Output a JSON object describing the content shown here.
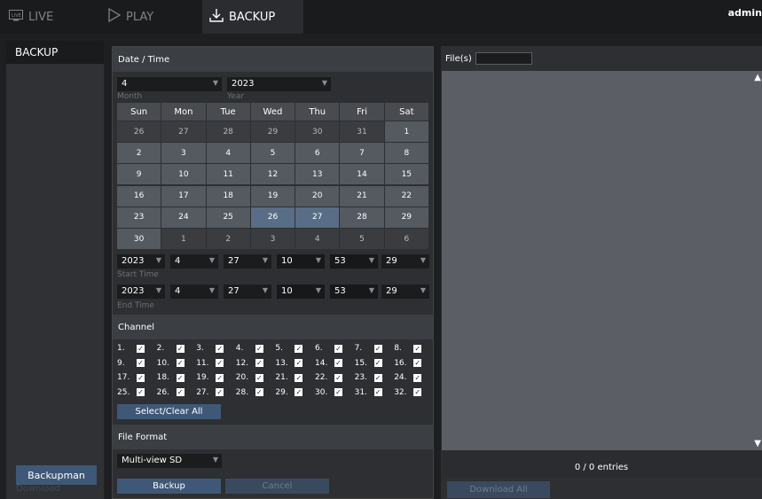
{
  "nav": {
    "tabs": [
      {
        "icon": "live-icon",
        "label": "LIVE"
      },
      {
        "icon": "play-icon",
        "label": "PLAY"
      },
      {
        "icon": "download-icon",
        "label": "BACKUP"
      }
    ],
    "user": "admin"
  },
  "sidebar": {
    "active_item": "BACKUP",
    "backupman_button": "Backupman",
    "download_label": "Download"
  },
  "date_time": {
    "header": "Date / Time",
    "month": {
      "value": "4",
      "label": "Month"
    },
    "year": {
      "value": "2023",
      "label": "Year"
    },
    "weekdays": [
      "Sun",
      "Mon",
      "Tue",
      "Wed",
      "Thu",
      "Fri",
      "Sat"
    ],
    "weeks": [
      [
        "26",
        "27",
        "28",
        "29",
        "30",
        "31",
        "1"
      ],
      [
        "2",
        "3",
        "4",
        "5",
        "6",
        "7",
        "8"
      ],
      [
        "9",
        "10",
        "11",
        "12",
        "13",
        "14",
        "15"
      ],
      [
        "16",
        "17",
        "18",
        "19",
        "20",
        "21",
        "22"
      ],
      [
        "23",
        "24",
        "25",
        "26",
        "27",
        "28",
        "29"
      ],
      [
        "30",
        "1",
        "2",
        "3",
        "4",
        "5",
        "6"
      ]
    ],
    "selected_days": [
      "26",
      "27"
    ],
    "start": {
      "year": "2023",
      "month": "4",
      "day": "27",
      "hour": "10",
      "minute": "53",
      "second": "29",
      "label": "Start Time"
    },
    "end": {
      "year": "2023",
      "month": "4",
      "day": "27",
      "hour": "10",
      "minute": "53",
      "second": "29",
      "label": "End Time"
    }
  },
  "channel": {
    "header": "Channel",
    "channels": [
      "1.",
      "2.",
      "3.",
      "4.",
      "5.",
      "6.",
      "7.",
      "8.",
      "9.",
      "10.",
      "11.",
      "12.",
      "13.",
      "14.",
      "15.",
      "16.",
      "17.",
      "18.",
      "19.",
      "20.",
      "21.",
      "22.",
      "23.",
      "24.",
      "25.",
      "26.",
      "27.",
      "28.",
      "29.",
      "30.",
      "31.",
      "32."
    ],
    "all_checked": true,
    "select_clear_button": "Select/Clear All"
  },
  "file_format": {
    "header": "File Format",
    "value": "Multi-view SD"
  },
  "actions": {
    "backup": "Backup",
    "cancel": "Cancel"
  },
  "files": {
    "label": "File(s)",
    "filter_value": "",
    "entries": "0 / 0 entries",
    "download_all": "Download All"
  },
  "colors": {
    "accent": "#3f5877",
    "selected_day": "#596d86",
    "panel": "#2d2f32",
    "list_bg": "#5b5f65"
  }
}
